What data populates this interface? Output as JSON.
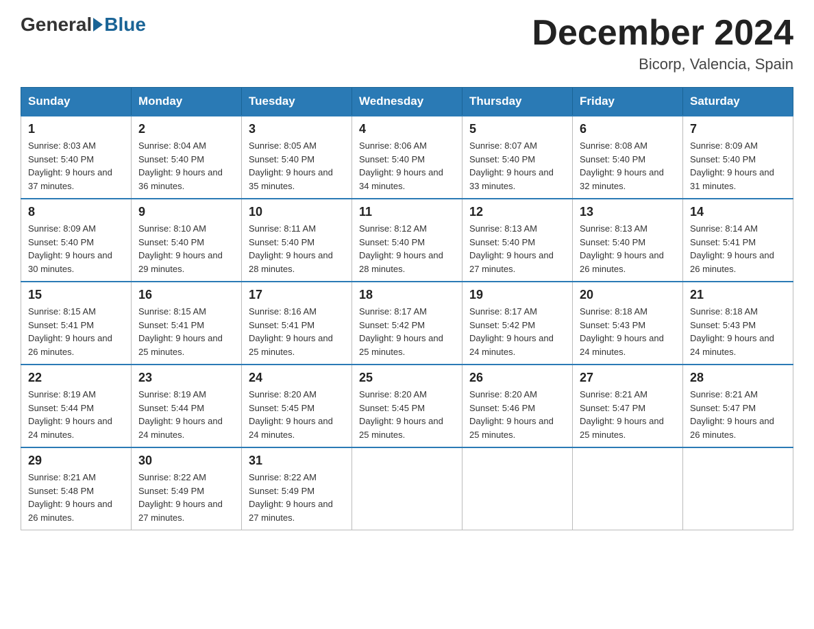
{
  "header": {
    "logo_general": "General",
    "logo_blue": "Blue",
    "month_title": "December 2024",
    "location": "Bicorp, Valencia, Spain"
  },
  "weekdays": [
    "Sunday",
    "Monday",
    "Tuesday",
    "Wednesday",
    "Thursday",
    "Friday",
    "Saturday"
  ],
  "weeks": [
    [
      {
        "day": "1",
        "sunrise": "8:03 AM",
        "sunset": "5:40 PM",
        "daylight": "9 hours and 37 minutes."
      },
      {
        "day": "2",
        "sunrise": "8:04 AM",
        "sunset": "5:40 PM",
        "daylight": "9 hours and 36 minutes."
      },
      {
        "day": "3",
        "sunrise": "8:05 AM",
        "sunset": "5:40 PM",
        "daylight": "9 hours and 35 minutes."
      },
      {
        "day": "4",
        "sunrise": "8:06 AM",
        "sunset": "5:40 PM",
        "daylight": "9 hours and 34 minutes."
      },
      {
        "day": "5",
        "sunrise": "8:07 AM",
        "sunset": "5:40 PM",
        "daylight": "9 hours and 33 minutes."
      },
      {
        "day": "6",
        "sunrise": "8:08 AM",
        "sunset": "5:40 PM",
        "daylight": "9 hours and 32 minutes."
      },
      {
        "day": "7",
        "sunrise": "8:09 AM",
        "sunset": "5:40 PM",
        "daylight": "9 hours and 31 minutes."
      }
    ],
    [
      {
        "day": "8",
        "sunrise": "8:09 AM",
        "sunset": "5:40 PM",
        "daylight": "9 hours and 30 minutes."
      },
      {
        "day": "9",
        "sunrise": "8:10 AM",
        "sunset": "5:40 PM",
        "daylight": "9 hours and 29 minutes."
      },
      {
        "day": "10",
        "sunrise": "8:11 AM",
        "sunset": "5:40 PM",
        "daylight": "9 hours and 28 minutes."
      },
      {
        "day": "11",
        "sunrise": "8:12 AM",
        "sunset": "5:40 PM",
        "daylight": "9 hours and 28 minutes."
      },
      {
        "day": "12",
        "sunrise": "8:13 AM",
        "sunset": "5:40 PM",
        "daylight": "9 hours and 27 minutes."
      },
      {
        "day": "13",
        "sunrise": "8:13 AM",
        "sunset": "5:40 PM",
        "daylight": "9 hours and 26 minutes."
      },
      {
        "day": "14",
        "sunrise": "8:14 AM",
        "sunset": "5:41 PM",
        "daylight": "9 hours and 26 minutes."
      }
    ],
    [
      {
        "day": "15",
        "sunrise": "8:15 AM",
        "sunset": "5:41 PM",
        "daylight": "9 hours and 26 minutes."
      },
      {
        "day": "16",
        "sunrise": "8:15 AM",
        "sunset": "5:41 PM",
        "daylight": "9 hours and 25 minutes."
      },
      {
        "day": "17",
        "sunrise": "8:16 AM",
        "sunset": "5:41 PM",
        "daylight": "9 hours and 25 minutes."
      },
      {
        "day": "18",
        "sunrise": "8:17 AM",
        "sunset": "5:42 PM",
        "daylight": "9 hours and 25 minutes."
      },
      {
        "day": "19",
        "sunrise": "8:17 AM",
        "sunset": "5:42 PM",
        "daylight": "9 hours and 24 minutes."
      },
      {
        "day": "20",
        "sunrise": "8:18 AM",
        "sunset": "5:43 PM",
        "daylight": "9 hours and 24 minutes."
      },
      {
        "day": "21",
        "sunrise": "8:18 AM",
        "sunset": "5:43 PM",
        "daylight": "9 hours and 24 minutes."
      }
    ],
    [
      {
        "day": "22",
        "sunrise": "8:19 AM",
        "sunset": "5:44 PM",
        "daylight": "9 hours and 24 minutes."
      },
      {
        "day": "23",
        "sunrise": "8:19 AM",
        "sunset": "5:44 PM",
        "daylight": "9 hours and 24 minutes."
      },
      {
        "day": "24",
        "sunrise": "8:20 AM",
        "sunset": "5:45 PM",
        "daylight": "9 hours and 24 minutes."
      },
      {
        "day": "25",
        "sunrise": "8:20 AM",
        "sunset": "5:45 PM",
        "daylight": "9 hours and 25 minutes."
      },
      {
        "day": "26",
        "sunrise": "8:20 AM",
        "sunset": "5:46 PM",
        "daylight": "9 hours and 25 minutes."
      },
      {
        "day": "27",
        "sunrise": "8:21 AM",
        "sunset": "5:47 PM",
        "daylight": "9 hours and 25 minutes."
      },
      {
        "day": "28",
        "sunrise": "8:21 AM",
        "sunset": "5:47 PM",
        "daylight": "9 hours and 26 minutes."
      }
    ],
    [
      {
        "day": "29",
        "sunrise": "8:21 AM",
        "sunset": "5:48 PM",
        "daylight": "9 hours and 26 minutes."
      },
      {
        "day": "30",
        "sunrise": "8:22 AM",
        "sunset": "5:49 PM",
        "daylight": "9 hours and 27 minutes."
      },
      {
        "day": "31",
        "sunrise": "8:22 AM",
        "sunset": "5:49 PM",
        "daylight": "9 hours and 27 minutes."
      },
      null,
      null,
      null,
      null
    ]
  ]
}
